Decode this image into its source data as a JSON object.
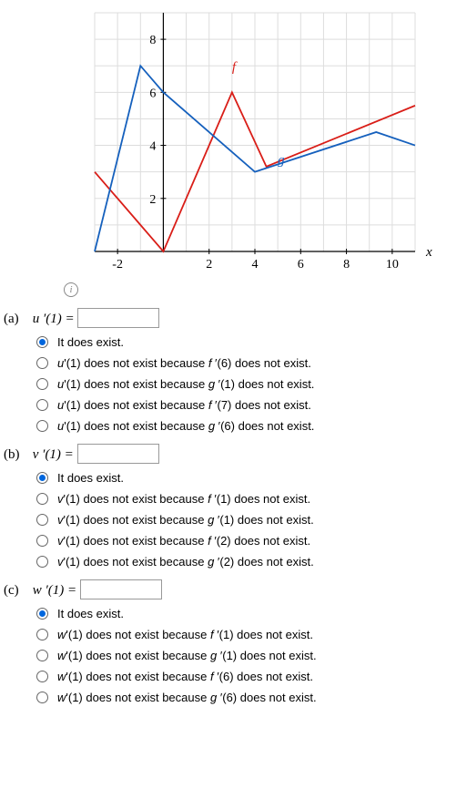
{
  "chart_data": {
    "type": "line",
    "xlabel": "x",
    "ylabel": "",
    "xlim": [
      -3,
      11
    ],
    "ylim": [
      0,
      9
    ],
    "x_ticks": [
      -2,
      2,
      4,
      6,
      8,
      10
    ],
    "y_ticks": [
      2,
      4,
      6,
      8
    ],
    "series": [
      {
        "name": "f",
        "color": "#d91e18",
        "label_pos": {
          "x": 3,
          "y": 6.8
        },
        "points": [
          {
            "x": -3,
            "y": 3
          },
          {
            "x": -1,
            "y": 1
          },
          {
            "x": 0,
            "y": 0
          },
          {
            "x": 3,
            "y": 6
          },
          {
            "x": 4.5,
            "y": 3.2
          },
          {
            "x": 11,
            "y": 5.5
          }
        ]
      },
      {
        "name": "g",
        "color": "#1560bd",
        "label_pos": {
          "x": 5,
          "y": 3.3
        },
        "points": [
          {
            "x": -3,
            "y": 0
          },
          {
            "x": -1,
            "y": 7
          },
          {
            "x": 0,
            "y": 6
          },
          {
            "x": 4,
            "y": 3
          },
          {
            "x": 9.3,
            "y": 4.5
          },
          {
            "x": 11,
            "y": 4
          }
        ]
      }
    ]
  },
  "questions": [
    {
      "part": "(a)",
      "equation": "u ′(1) =",
      "value": "",
      "options": [
        "It does exist.",
        "<i>u</i>'(1) does not exist because <i>f</i> ′(6) does not exist.",
        "<i>u</i>'(1) does not exist because <i>g</i> ′(1) does not exist.",
        "<i>u</i>'(1) does not exist because <i>f</i> ′(7) does not exist.",
        "<i>u</i>'(1) does not exist because <i>g</i> ′(6) does not exist."
      ],
      "selected": 0
    },
    {
      "part": "(b)",
      "equation": "v ′(1) =",
      "value": "",
      "options": [
        "It does exist.",
        "<i>v</i>'(1) does not exist because <i>f</i> ′(1) does not exist.",
        "<i>v</i>'(1) does not exist because <i>g</i> ′(1) does not exist.",
        "<i>v</i>'(1) does not exist because <i>f</i> ′(2) does not exist.",
        "<i>v</i>'(1) does not exist because <i>g</i> ′(2) does not exist."
      ],
      "selected": 0
    },
    {
      "part": "(c)",
      "equation": "w ′(1) =",
      "value": "",
      "options": [
        "It does exist.",
        "<i>w</i>'(1) does not exist because <i>f</i> ′(1) does not exist.",
        "<i>w</i>'(1) does not exist because <i>g</i> ′(1) does not exist.",
        "<i>w</i>'(1) does not exist because <i>f</i> ′(6) does not exist.",
        "<i>w</i>'(1) does not exist because <i>g</i> ′(6) does not exist."
      ],
      "selected": 0
    }
  ]
}
